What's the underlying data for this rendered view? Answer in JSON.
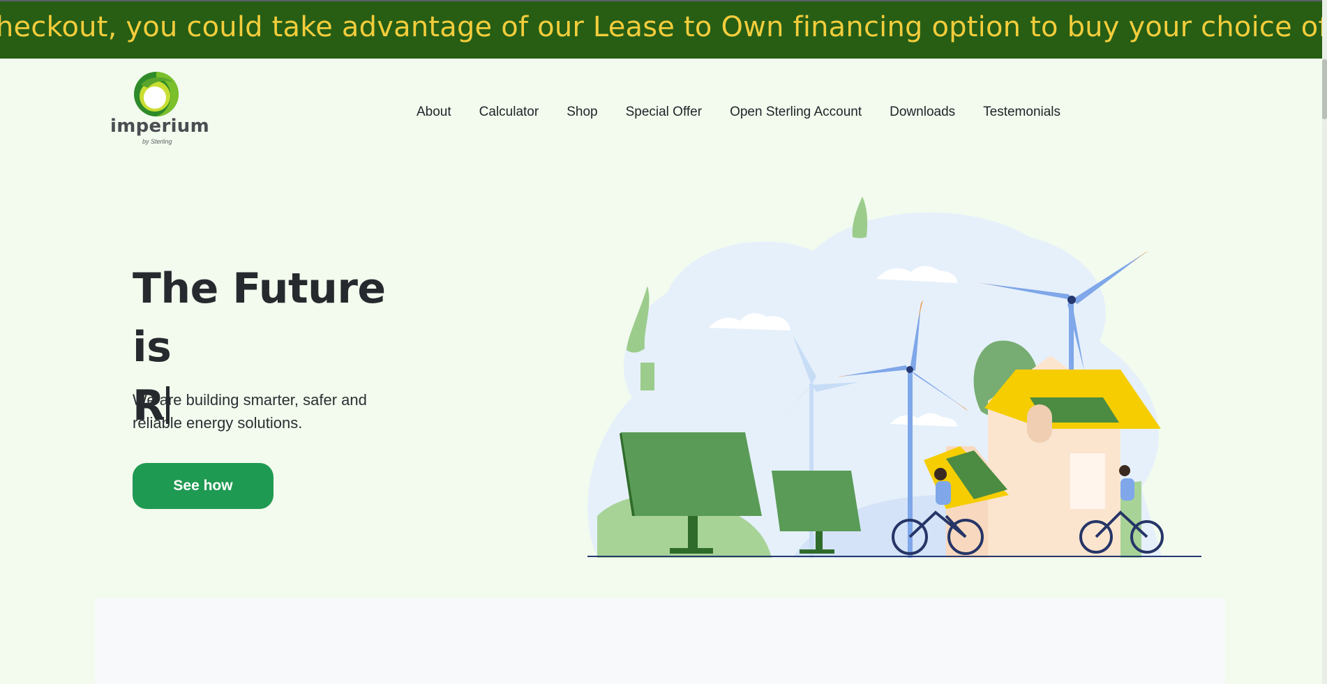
{
  "ticker": {
    "text": "heckout, you could take advantage of our Lease to Own financing option to buy your choice of produ"
  },
  "brand": {
    "name": "imperium",
    "tagline": "by Sterling"
  },
  "nav": {
    "items": [
      {
        "label": "About"
      },
      {
        "label": "Calculator"
      },
      {
        "label": "Shop"
      },
      {
        "label": "Special Offer"
      },
      {
        "label": "Open Sterling Account"
      },
      {
        "label": "Downloads"
      },
      {
        "label": "Testemonials"
      }
    ]
  },
  "hero": {
    "title_line1": "The Future is",
    "title_line2": "R",
    "subtitle": "We are building smarter, safer and reliable energy solutions.",
    "cta_label": "See how"
  },
  "colors": {
    "ticker_bg": "#275e14",
    "ticker_text": "#f3cd3c",
    "page_bg": "#f2fbee",
    "cta_bg": "#1f9a52",
    "accent_green": "#5c9a56"
  },
  "icons": {
    "logo": "imperium-leaf-ring-logo",
    "illustration": "renewable-energy-scene-illustration"
  }
}
